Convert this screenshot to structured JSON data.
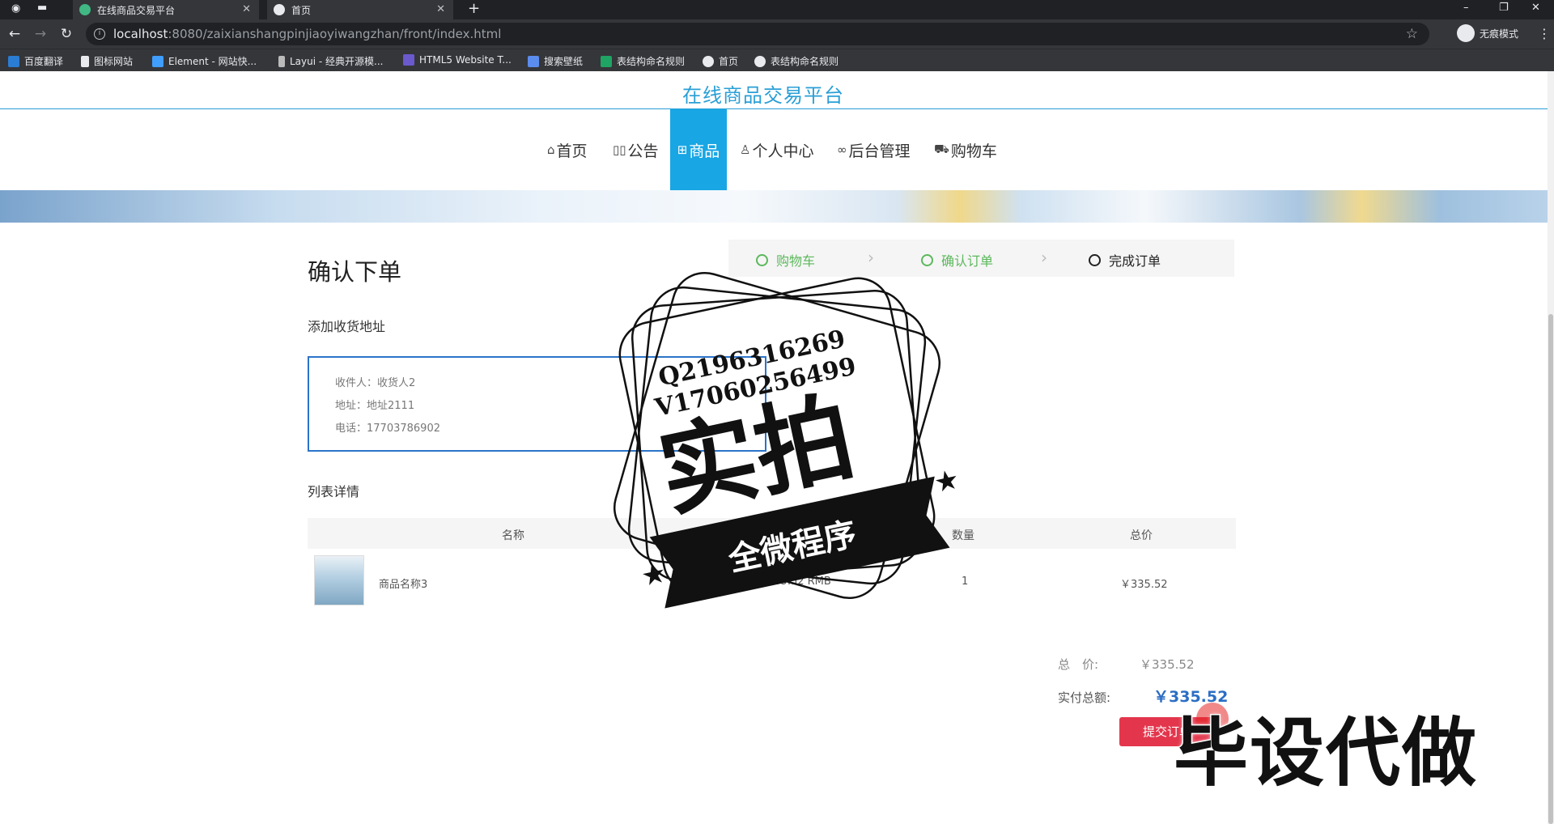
{
  "browser": {
    "tabs": [
      {
        "title": "在线商品交易平台"
      },
      {
        "title": "首页"
      }
    ],
    "url_host": "localhost",
    "url_path": ":8080/zaixianshangpinjiaoyiwangzhan/front/index.html",
    "profile_label": "无痕模式",
    "bookmarks": [
      "百度翻译",
      "图标网站",
      "Element - 网站快...",
      "Layui - 经典开源模...",
      "HTML5 Website T...",
      "搜索壁纸",
      "表结构命名规则",
      "首页",
      "表结构命名规则"
    ]
  },
  "site": {
    "title": "在线商品交易平台",
    "nav": [
      {
        "label": "首页",
        "icon": "home-icon"
      },
      {
        "label": "公告",
        "icon": "announcement-icon"
      },
      {
        "label": "商品",
        "icon": "grid-icon",
        "active": true
      },
      {
        "label": "个人中心",
        "icon": "user-icon"
      },
      {
        "label": "后台管理",
        "icon": "link-icon"
      },
      {
        "label": "购物车",
        "icon": "cart-icon"
      }
    ]
  },
  "order": {
    "heading": "确认下单",
    "steps": [
      {
        "label": "购物车",
        "state": "done"
      },
      {
        "label": "确认订单",
        "state": "done"
      },
      {
        "label": "完成订单",
        "state": "current"
      }
    ],
    "address_section": "添加收货地址",
    "address": {
      "receiver": "收件人：收货人2",
      "addr": "地址：地址2111",
      "phone": "电话：17703786902"
    },
    "list_section": "列表详情",
    "columns": [
      "名称",
      "数量",
      "总价"
    ],
    "items": [
      {
        "name": "商品名称3",
        "price": "335.52 RMB",
        "qty": "1",
        "total": "￥335.52"
      }
    ],
    "total_label": "总　价:",
    "total_value": "￥335.52",
    "pay_label": "实付总额:",
    "pay_value": "￥335.52",
    "submit_label": "提交订单"
  },
  "watermark": {
    "contact_q": "Q2196316269",
    "contact_v": "V17060256499",
    "stamp_main": "实拍",
    "stamp_ribbon": "全微程序",
    "corner": "毕设代做"
  },
  "colors": {
    "accent": "#18a6e4",
    "title": "#2a9fd6",
    "step_done": "#5cb85c",
    "submit": "#e3364c",
    "pay": "#2b6ec4"
  }
}
